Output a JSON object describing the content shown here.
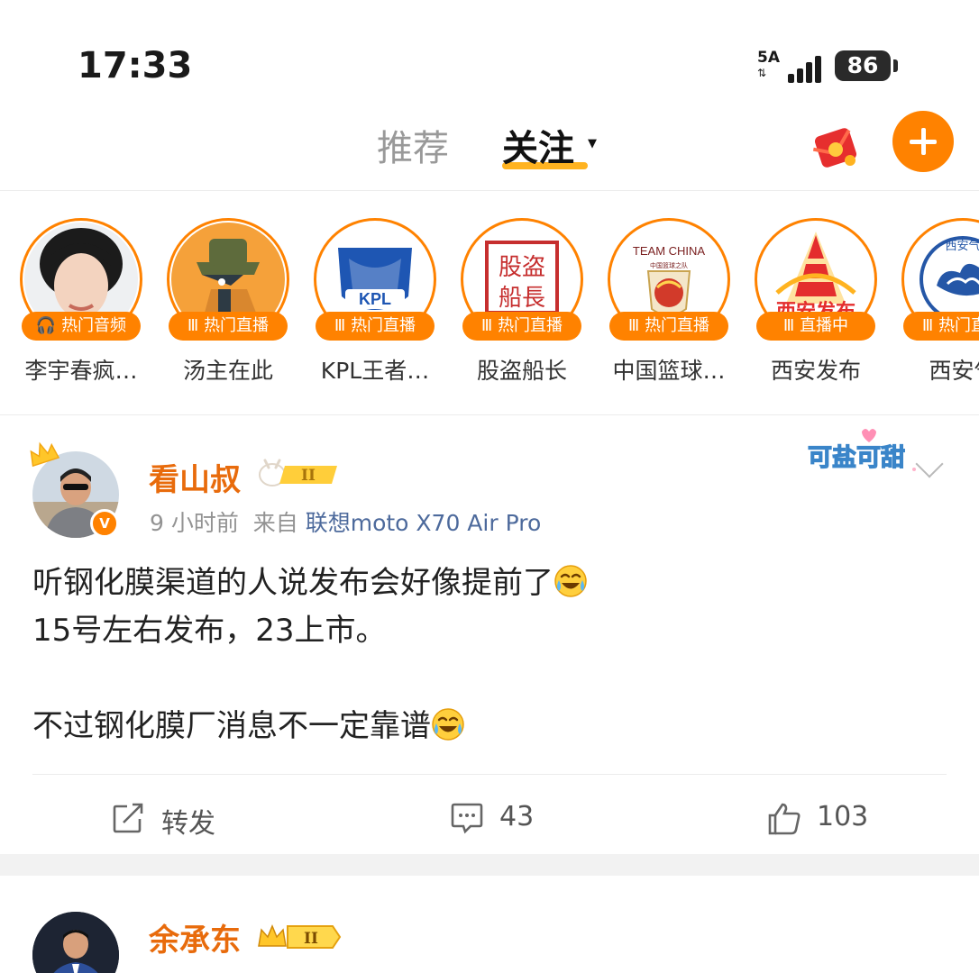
{
  "status_bar": {
    "time": "17:33",
    "network": "5A",
    "battery": "86"
  },
  "nav": {
    "tabs": [
      {
        "label": "推荐",
        "active": false
      },
      {
        "label": "关注",
        "active": true
      }
    ],
    "icons": [
      "red-packet-icon",
      "plus-icon"
    ],
    "accent_color": "#ff8200"
  },
  "live_strip": [
    {
      "badge": "热门音频",
      "name": "李宇春疯…",
      "badge_icon": "headphones-icon"
    },
    {
      "badge": "热门直播",
      "name": "汤主在此",
      "badge_icon": "live-bars-icon"
    },
    {
      "badge": "热门直播",
      "name": "KPL王者…",
      "badge_icon": "live-bars-icon",
      "logo_text": "KPL"
    },
    {
      "badge": "热门直播",
      "name": "股盗船长",
      "badge_icon": "live-bars-icon",
      "logo_text": "股盗船長"
    },
    {
      "badge": "热门直播",
      "name": "中国篮球…",
      "badge_icon": "live-bars-icon",
      "logo_text": "TEAM CHINA",
      "logo_subtext": "中国篮球之队"
    },
    {
      "badge": "直播中",
      "name": "西安发布",
      "badge_icon": "live-bars-icon",
      "logo_text": "西安发布"
    },
    {
      "badge": "热门直播",
      "name": "西安气",
      "badge_icon": "live-bars-icon",
      "logo_text": "西安气"
    }
  ],
  "posts": [
    {
      "author": "看山叔",
      "level": "II",
      "time": "9 小时前",
      "source_prefix": "来自",
      "device": "联想moto X70 Air Pro",
      "sticker": "可盐可甜",
      "lines": [
        "听钢化膜渠道的人说发布会好像提前了",
        "15号左右发布，23上市。",
        "",
        "不过钢化膜厂消息不一定靠谱"
      ],
      "actions": {
        "repost": "转发",
        "comments": "43",
        "likes": "103"
      }
    },
    {
      "author": "余承东",
      "level": "II"
    }
  ]
}
